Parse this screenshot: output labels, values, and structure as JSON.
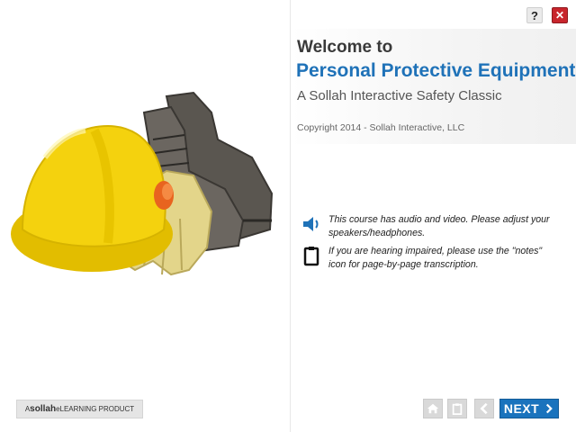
{
  "header": {
    "help_label": "?",
    "close_label": "✕"
  },
  "title_band": {
    "welcome": "Welcome to",
    "course_title": "Personal Protective Equipment",
    "subtitle": "A Sollah Interactive Safety Classic",
    "copyright": "Copyright 2014 - Sollah Interactive, LLC"
  },
  "notices": [
    {
      "icon": "speaker-icon",
      "text": "This course has audio and video. Please adjust your speakers/headphones."
    },
    {
      "icon": "notes-icon",
      "text": "If you are hearing impaired, please use the \"notes\" icon for page-by-page transcription."
    }
  ],
  "footer": {
    "badge_prefix": "A ",
    "badge_brand": "sollah",
    "badge_suffix": " eLEARNING PRODUCT",
    "next_label": "NEXT"
  },
  "colors": {
    "accent_blue": "#1f72b8",
    "close_red": "#c8252c",
    "hardhat_yellow": "#f4d20e"
  },
  "hero_image": {
    "icons": [
      "hard-hat",
      "work-gloves",
      "safety-boots",
      "earplug"
    ]
  }
}
